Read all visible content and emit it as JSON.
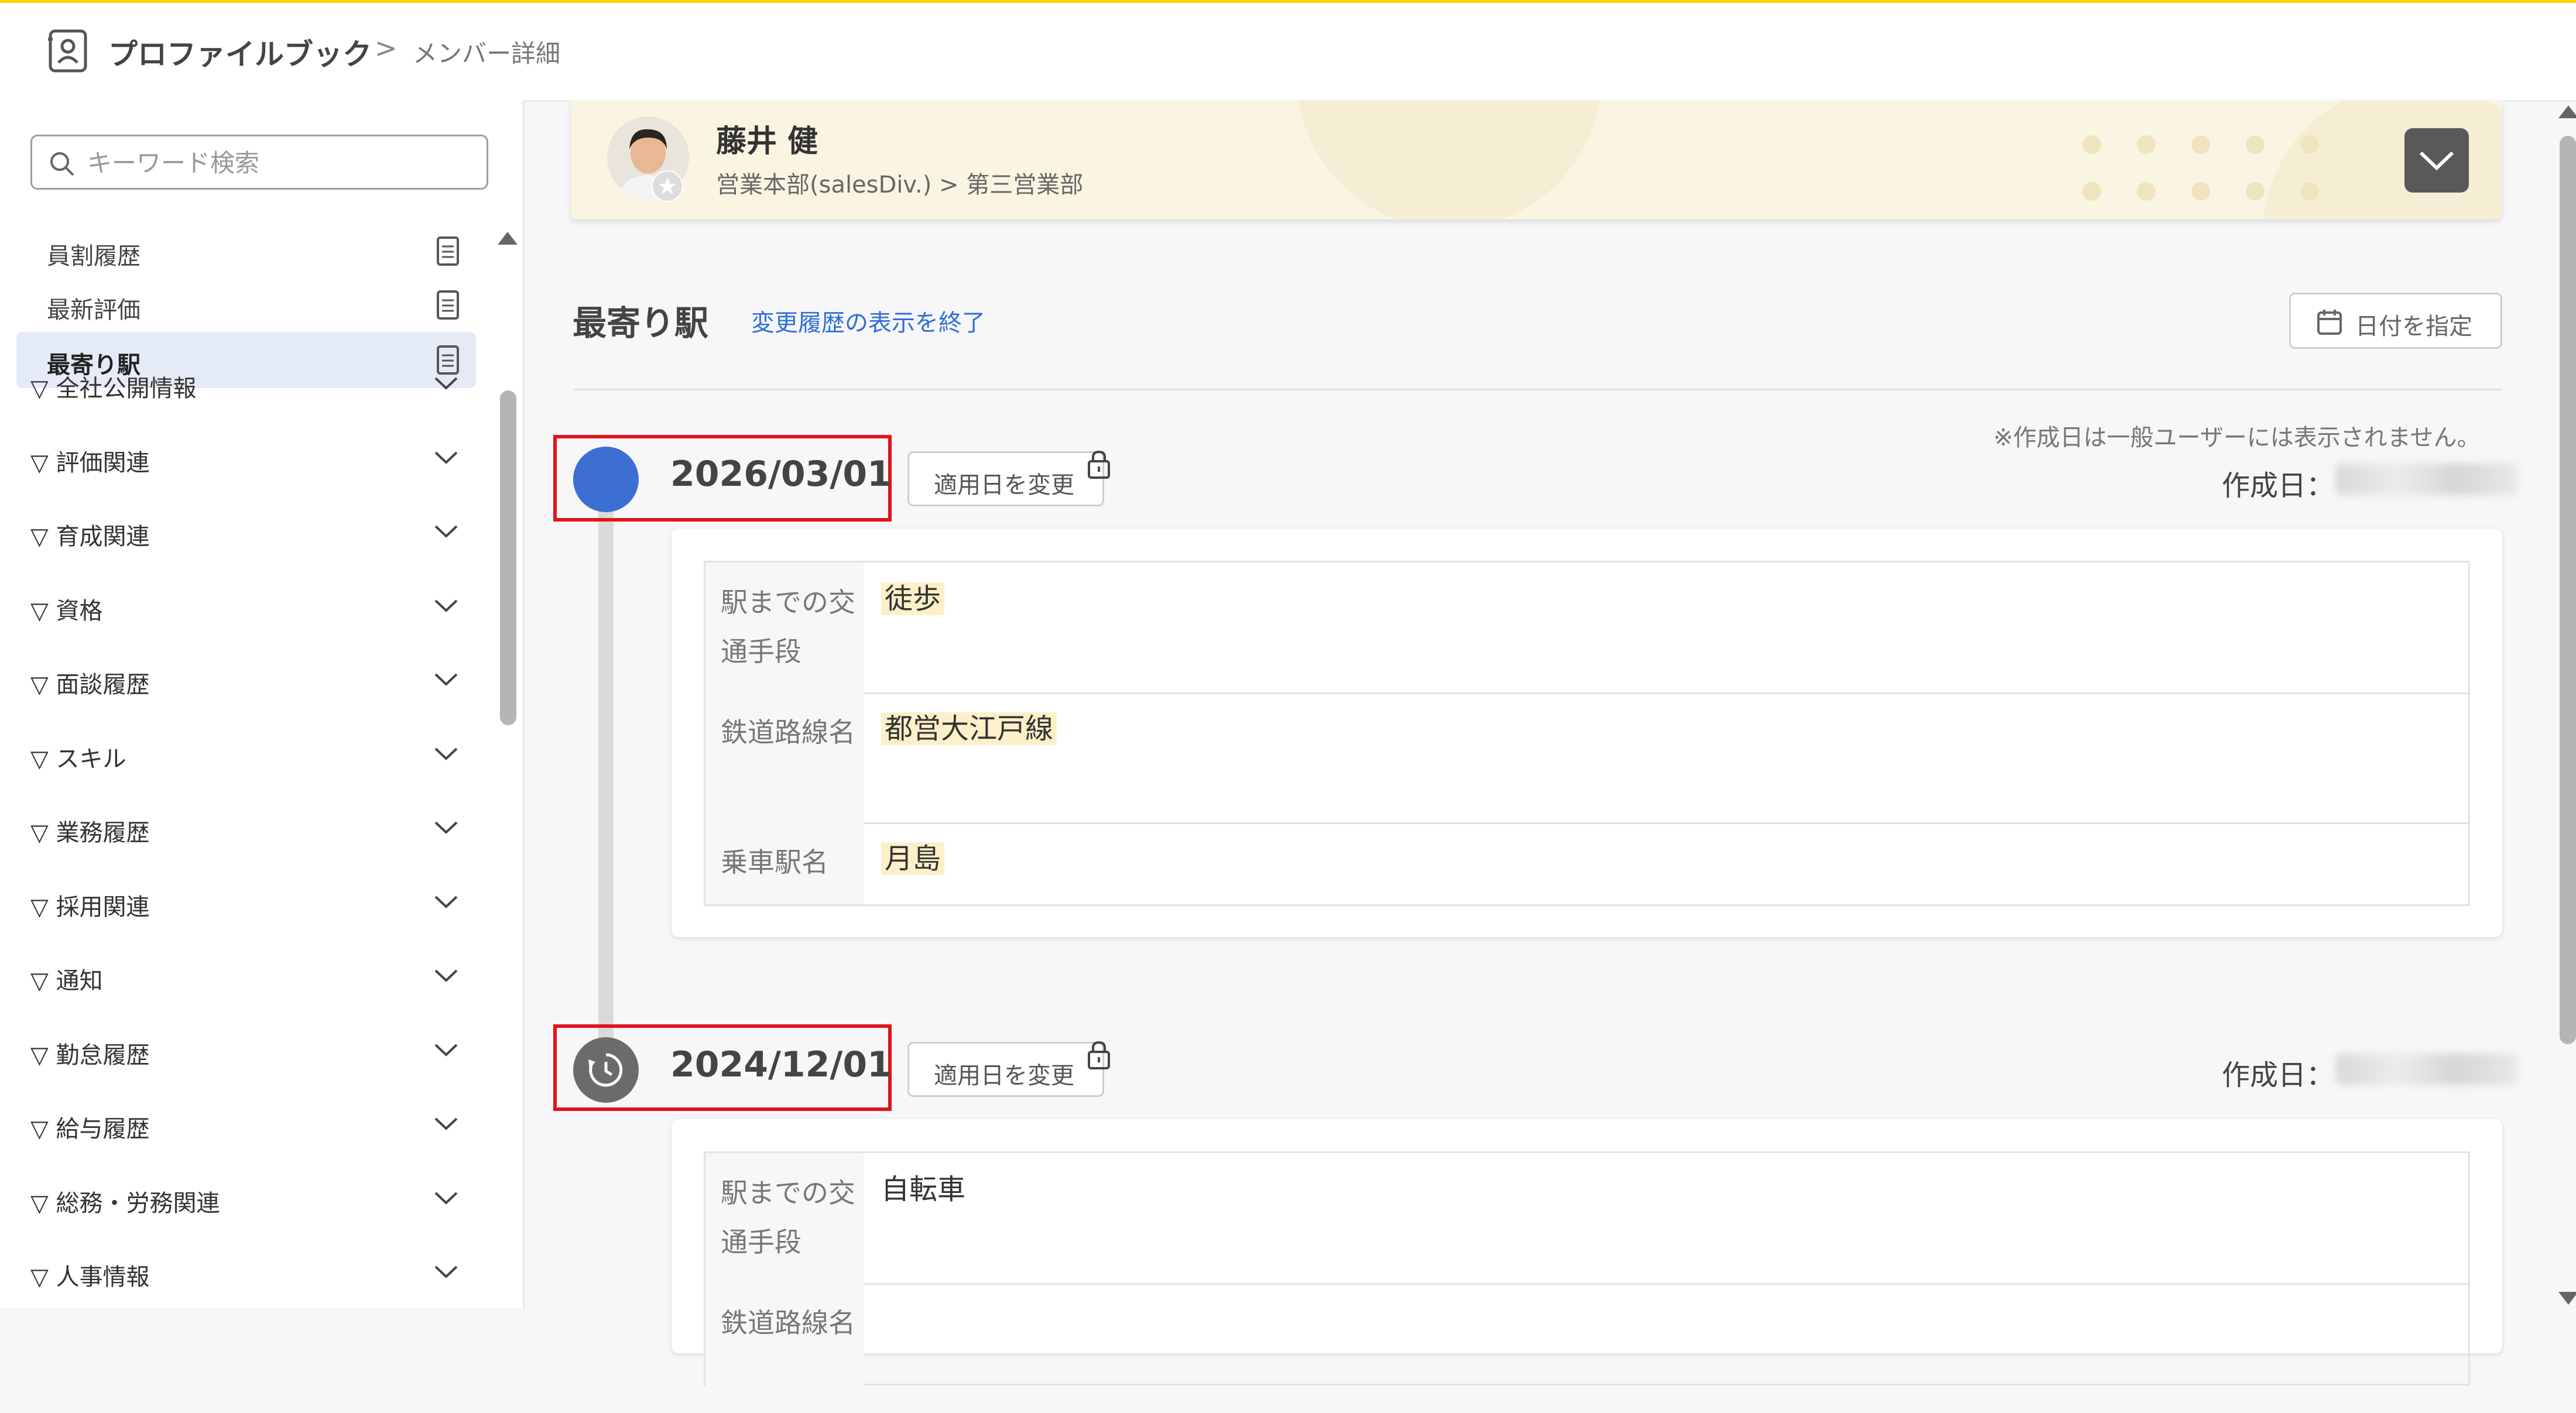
{
  "header": {
    "app_title": "プロファイルブック",
    "separator": ">",
    "page": "メンバー詳細"
  },
  "sidebar": {
    "search_placeholder": "キーワード検索",
    "sub_items": [
      {
        "label": "員割履歴",
        "active": false
      },
      {
        "label": "最新評価",
        "active": false
      },
      {
        "label": "最寄り駅",
        "active": true
      }
    ],
    "groups": [
      "▽ 全社公開情報",
      "▽ 評価関連",
      "▽ 育成関連",
      "▽ 資格",
      "▽ 面談履歴",
      "▽ スキル",
      "▽ 業務履歴",
      "▽ 採用関連",
      "▽ 通知",
      "▽ 勤怠履歴",
      "▽ 給与履歴",
      "▽ 総務・労務関連",
      "▽ 人事情報"
    ]
  },
  "profile": {
    "name": "藤井 健",
    "department": "営業本部(salesDiv.) > 第三営業部"
  },
  "section": {
    "title": "最寄り駅",
    "history_link": "変更履歴の表示を終了",
    "date_button": "日付を指定",
    "note": "※作成日は一般ユーザーには表示されません。",
    "created_label": "作成日：",
    "change_button": "適用日を変更"
  },
  "entries": [
    {
      "date": "2026/03/01",
      "status": "current",
      "fields": [
        {
          "key": "駅までの交通手段",
          "value": "徒歩",
          "highlight": true
        },
        {
          "key": "鉄道路線名",
          "value": "都営大江戸線",
          "highlight": true
        },
        {
          "key": "乗車駅名",
          "value": "月島",
          "highlight": true
        }
      ]
    },
    {
      "date": "2024/12/01",
      "status": "past",
      "fields": [
        {
          "key": "駅までの交通手段",
          "value": "自転車",
          "highlight": false
        },
        {
          "key": "鉄道路線名",
          "value": "",
          "highlight": false
        }
      ]
    }
  ],
  "colors": {
    "accent_blue": "#3c6fd1",
    "link_blue": "#2f6fd6",
    "highlight_red": "#e0141b",
    "top_bar_yellow": "#ffd600",
    "profile_bg": "#faf5e2",
    "value_highlight": "#fdf0c9"
  },
  "icons": {
    "app": "profile-book-icon",
    "search": "search-icon",
    "document": "document-icon",
    "chevron": "chevron-down-icon",
    "calendar": "calendar-icon",
    "lock": "lock-icon",
    "history": "history-icon"
  }
}
